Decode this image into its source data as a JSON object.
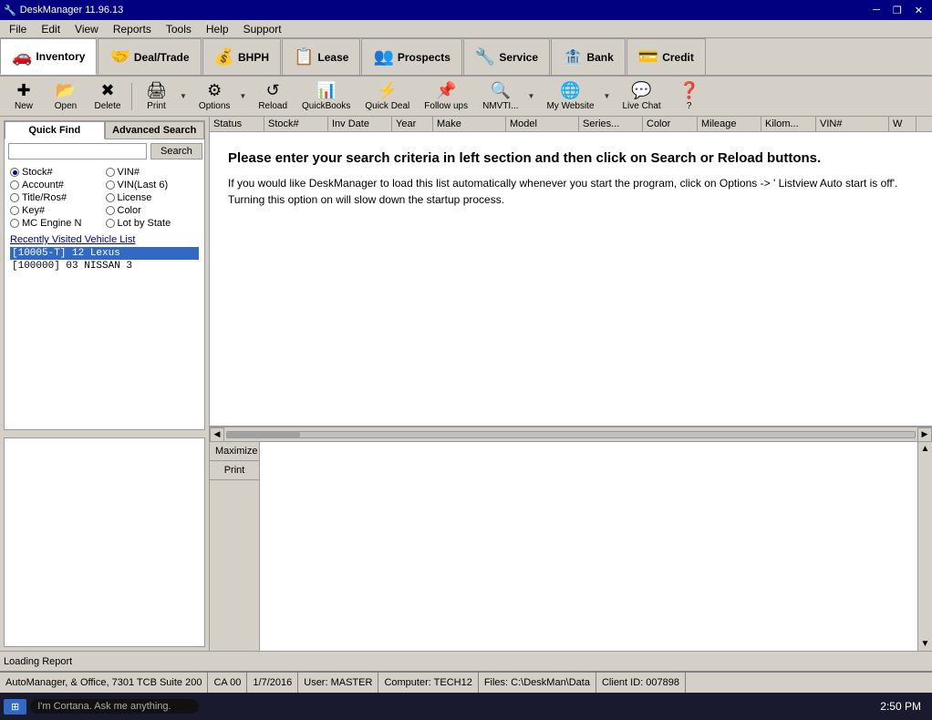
{
  "app": {
    "title": "DeskManager 11.96.13",
    "icon": "🔧"
  },
  "window_controls": {
    "minimize": "─",
    "restore": "❐",
    "close": "✕"
  },
  "menu": {
    "items": [
      "File",
      "Edit",
      "View",
      "Reports",
      "Tools",
      "Help",
      "Support"
    ]
  },
  "nav_tabs": [
    {
      "id": "inventory",
      "label": "Inventory",
      "icon": "🚗",
      "active": true
    },
    {
      "id": "deal-trade",
      "label": "Deal/Trade",
      "icon": "🤝"
    },
    {
      "id": "bhph",
      "label": "BHPH",
      "icon": "💰"
    },
    {
      "id": "lease",
      "label": "Lease",
      "icon": "📋"
    },
    {
      "id": "prospects",
      "label": "Prospects",
      "icon": "👥"
    },
    {
      "id": "service",
      "label": "Service",
      "icon": "🔧"
    },
    {
      "id": "bank",
      "label": "Bank",
      "icon": "🏦"
    },
    {
      "id": "credit",
      "label": "Credit",
      "icon": "💳"
    }
  ],
  "toolbar": {
    "buttons": [
      {
        "id": "new",
        "label": "New",
        "icon": "✚",
        "color": "#00aa00"
      },
      {
        "id": "open",
        "label": "Open",
        "icon": "📂",
        "color": "#f4a400"
      },
      {
        "id": "delete",
        "label": "Delete",
        "icon": "✖",
        "color": "#cc0000"
      },
      {
        "id": "print",
        "label": "Print",
        "icon": "🖨",
        "has_arrow": true
      },
      {
        "id": "options",
        "label": "Options",
        "icon": "⚙",
        "has_arrow": true
      },
      {
        "id": "reload",
        "label": "Reload",
        "icon": "↺"
      },
      {
        "id": "quickbooks",
        "label": "QuickBooks",
        "icon": "📊"
      },
      {
        "id": "quick-deal",
        "label": "Quick Deal",
        "icon": "⚡"
      },
      {
        "id": "follow-ups",
        "label": "Follow ups",
        "icon": "📌"
      },
      {
        "id": "nmvtis",
        "label": "NMVTI...",
        "icon": "🔍",
        "has_arrow": true
      },
      {
        "id": "my-website",
        "label": "My Website",
        "icon": "🌐",
        "has_arrow": true
      },
      {
        "id": "live-chat",
        "label": "Live Chat",
        "icon": "💬"
      },
      {
        "id": "help",
        "label": "?",
        "icon": "❓"
      }
    ]
  },
  "quick_find": {
    "tab_label": "Quick Find",
    "advanced_label": "Advanced Search",
    "search_placeholder": "",
    "search_button": "Search",
    "radio_options": [
      {
        "id": "stock",
        "label": "Stock#",
        "selected": true
      },
      {
        "id": "vin",
        "label": "VIN#",
        "selected": false
      },
      {
        "id": "account",
        "label": "Account#",
        "selected": false
      },
      {
        "id": "vin-last6",
        "label": "VIN(Last 6)",
        "selected": false
      },
      {
        "id": "title-ros",
        "label": "Title/Ros#",
        "selected": false
      },
      {
        "id": "license",
        "label": "License",
        "selected": false
      },
      {
        "id": "key",
        "label": "Key#",
        "selected": false
      },
      {
        "id": "color",
        "label": "Color",
        "selected": false
      },
      {
        "id": "mc-engine",
        "label": "MC Engine N",
        "selected": false
      },
      {
        "id": "lot-by-state",
        "label": "Lot by State",
        "selected": false
      }
    ],
    "recently_visited_label": "Recently Visited Vehicle List",
    "recently_visited": [
      {
        "id": "10005-T",
        "text": "[10005-T]  12 Lexus",
        "selected": true
      },
      {
        "id": "100000",
        "text": "[100000]   03 NISSAN  3",
        "selected": false
      }
    ]
  },
  "table": {
    "columns": [
      {
        "id": "status",
        "label": "Status",
        "width": 60
      },
      {
        "id": "stock",
        "label": "Stock#",
        "width": 70
      },
      {
        "id": "inv-date",
        "label": "Inv Date",
        "width": 70
      },
      {
        "id": "year",
        "label": "Year",
        "width": 45
      },
      {
        "id": "make",
        "label": "Make",
        "width": 80
      },
      {
        "id": "model",
        "label": "Model",
        "width": 80
      },
      {
        "id": "series",
        "label": "Series...",
        "width": 70
      },
      {
        "id": "color",
        "label": "Color",
        "width": 60
      },
      {
        "id": "mileage",
        "label": "Mileage",
        "width": 70
      },
      {
        "id": "kilom",
        "label": "Kilom...",
        "width": 60
      },
      {
        "id": "vin",
        "label": "VIN#",
        "width": 80
      },
      {
        "id": "w",
        "label": "W",
        "width": 30
      }
    ]
  },
  "search_message": {
    "heading": "Please enter your search criteria in left section and then click on Search or Reload buttons.",
    "body": "If you would like DeskManager to load this list automatically whenever you start the program, click on Options -> ' Listview Auto start is off'. Turning this option on will slow down the startup process."
  },
  "report": {
    "maximize_btn": "Maximize",
    "print_btn": "Print"
  },
  "status_bar": {
    "text": "Loading Report"
  },
  "bottom_status": {
    "company": "AutoManager, & Office, 7301 TCB Suite 200",
    "state": "CA 00",
    "date": "1/7/2016",
    "user": "User: MASTER",
    "computer": "Computer: TECH12",
    "files": "Files: C:\\DeskMan\\Data",
    "client": "Client ID: 007898"
  },
  "taskbar": {
    "time": "2:50 PM",
    "date": ""
  }
}
